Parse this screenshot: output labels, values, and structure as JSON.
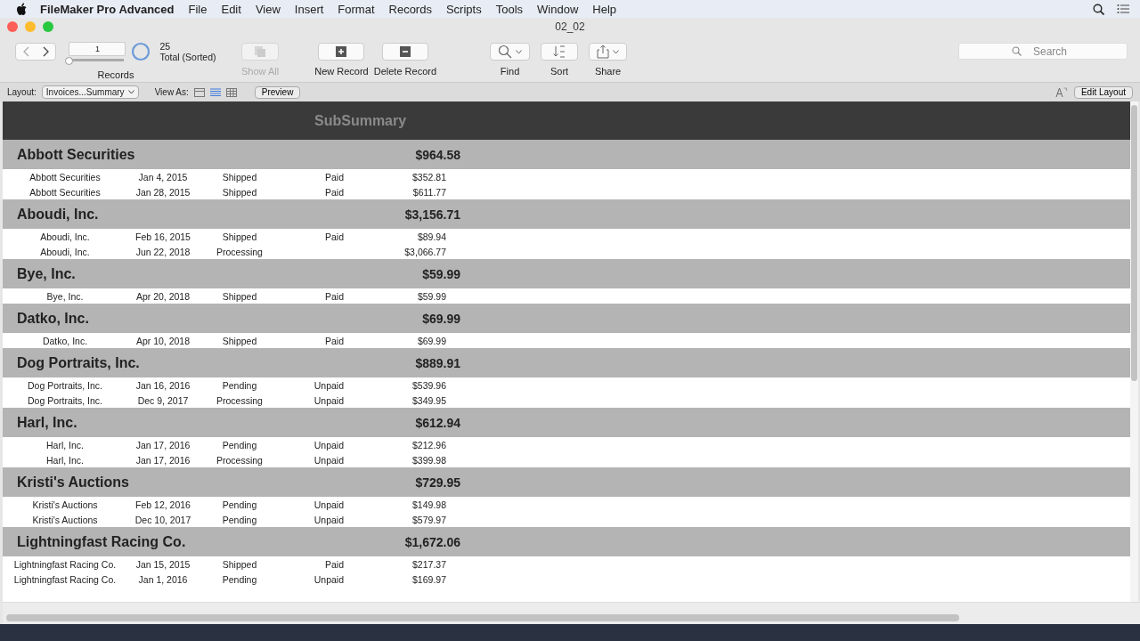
{
  "menu_bar": {
    "app_name": "FileMaker Pro Advanced",
    "items": [
      "File",
      "Edit",
      "View",
      "Insert",
      "Format",
      "Records",
      "Scripts",
      "Tools",
      "Window",
      "Help"
    ]
  },
  "window": {
    "title": "02_02"
  },
  "toolbar": {
    "record_number": "1",
    "record_slider": {
      "level": 0.0
    },
    "found_count": "25",
    "found_status": "Total (Sorted)",
    "records_label": "Records",
    "buttons": [
      {
        "label": "Show All",
        "disabled": true,
        "kind": "showall"
      },
      {
        "label": "New Record",
        "disabled": false,
        "kind": "new"
      },
      {
        "label": "Delete Record",
        "disabled": false,
        "kind": "delete"
      },
      {
        "label": "Find",
        "disabled": false,
        "kind": "find"
      },
      {
        "label": "Sort",
        "disabled": false,
        "kind": "sort"
      },
      {
        "label": "Share",
        "disabled": false,
        "kind": "share"
      }
    ],
    "search": {
      "placeholder": "Search"
    }
  },
  "layout_bar": {
    "layout_label": "Layout:",
    "layout_value": "Invoices...Summary",
    "view_as_label": "View As:",
    "views": [
      {
        "kind": "form",
        "selected": false
      },
      {
        "kind": "list",
        "selected": true
      },
      {
        "kind": "table",
        "selected": false
      }
    ],
    "preview": "Preview",
    "edit_layout": "Edit Layout"
  },
  "report": {
    "header": "SubSummary",
    "groups": [
      {
        "name": "Abbott Securities",
        "total": "$964.58",
        "rows": [
          [
            "Abbott Securities",
            "Jan 4, 2015",
            "Shipped",
            "Paid",
            "$352.81"
          ],
          [
            "Abbott Securities",
            "Jan 28, 2015",
            "Shipped",
            "Paid",
            "$611.77"
          ]
        ]
      },
      {
        "name": "Aboudi, Inc.",
        "total": "$3,156.71",
        "rows": [
          [
            "Aboudi, Inc.",
            "Feb 16, 2015",
            "Shipped",
            "Paid",
            "$89.94"
          ],
          [
            "Aboudi, Inc.",
            "Jun 22, 2018",
            "Processing",
            "",
            "$3,066.77"
          ]
        ]
      },
      {
        "name": "Bye, Inc.",
        "total": "$59.99",
        "rows": [
          [
            "Bye, Inc.",
            "Apr 20, 2018",
            "Shipped",
            "Paid",
            "$59.99"
          ]
        ]
      },
      {
        "name": "Datko, Inc.",
        "total": "$69.99",
        "rows": [
          [
            "Datko, Inc.",
            "Apr 10, 2018",
            "Shipped",
            "Paid",
            "$69.99"
          ]
        ]
      },
      {
        "name": "Dog Portraits, Inc.",
        "total": "$889.91",
        "rows": [
          [
            "Dog Portraits, Inc.",
            "Jan 16, 2016",
            "Pending",
            "Unpaid",
            "$539.96"
          ],
          [
            "Dog Portraits, Inc.",
            "Dec 9, 2017",
            "Processing",
            "Unpaid",
            "$349.95"
          ]
        ]
      },
      {
        "name": "Harl, Inc.",
        "total": "$612.94",
        "rows": [
          [
            "Harl, Inc.",
            "Jan 17, 2016",
            "Pending",
            "Unpaid",
            "$212.96"
          ],
          [
            "Harl, Inc.",
            "Jan 17, 2016",
            "Processing",
            "Unpaid",
            "$399.98"
          ]
        ]
      },
      {
        "name": "Kristi's Auctions",
        "total": "$729.95",
        "rows": [
          [
            "Kristi's Auctions",
            "Feb 12, 2016",
            "Pending",
            "Unpaid",
            "$149.98"
          ],
          [
            "Kristi's Auctions",
            "Dec 10, 2017",
            "Pending",
            "Unpaid",
            "$579.97"
          ]
        ]
      },
      {
        "name": "Lightningfast Racing Co.",
        "total": "$1,672.06",
        "rows": [
          [
            "Lightningfast Racing Co.",
            "Jan 15, 2015",
            "Shipped",
            "Paid",
            "$217.37"
          ],
          [
            "Lightningfast Racing Co.",
            "Jan 1, 2016",
            "Pending",
            "Unpaid",
            "$169.97"
          ]
        ]
      }
    ]
  }
}
